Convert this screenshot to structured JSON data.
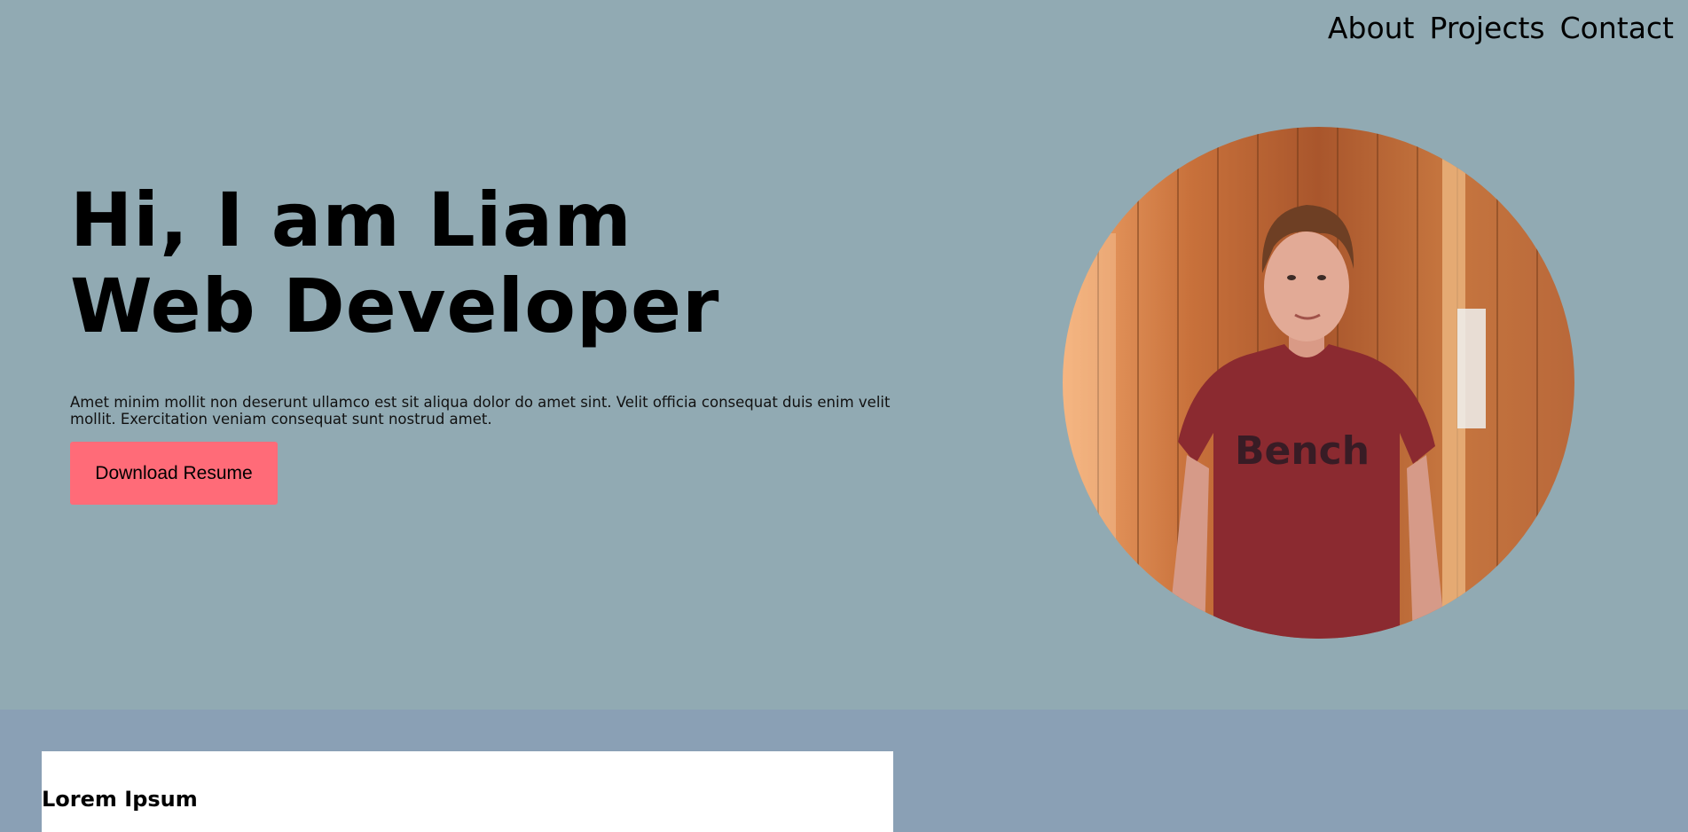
{
  "nav": {
    "items": [
      {
        "label": "About"
      },
      {
        "label": "Projects"
      },
      {
        "label": "Contact"
      }
    ]
  },
  "hero": {
    "headline_line1": "Hi, I am Liam",
    "headline_line2": "Web Developer",
    "blurb": "Amet minim mollit non deserunt ullamco est sit aliqua dolor do amet sint. Velit officia consequat duis enim velit mollit. Exercitation veniam consequat sunt nostrud amet.",
    "button_label": "Download Resume",
    "portrait_shirt_text": "Bench"
  },
  "section": {
    "card_title": "Lorem Ipsum"
  },
  "colors": {
    "hero_bg": "#91aab3",
    "lower_bg": "#8aa0b5",
    "button_bg": "#ff6b78",
    "card_bg": "#ffffff"
  }
}
